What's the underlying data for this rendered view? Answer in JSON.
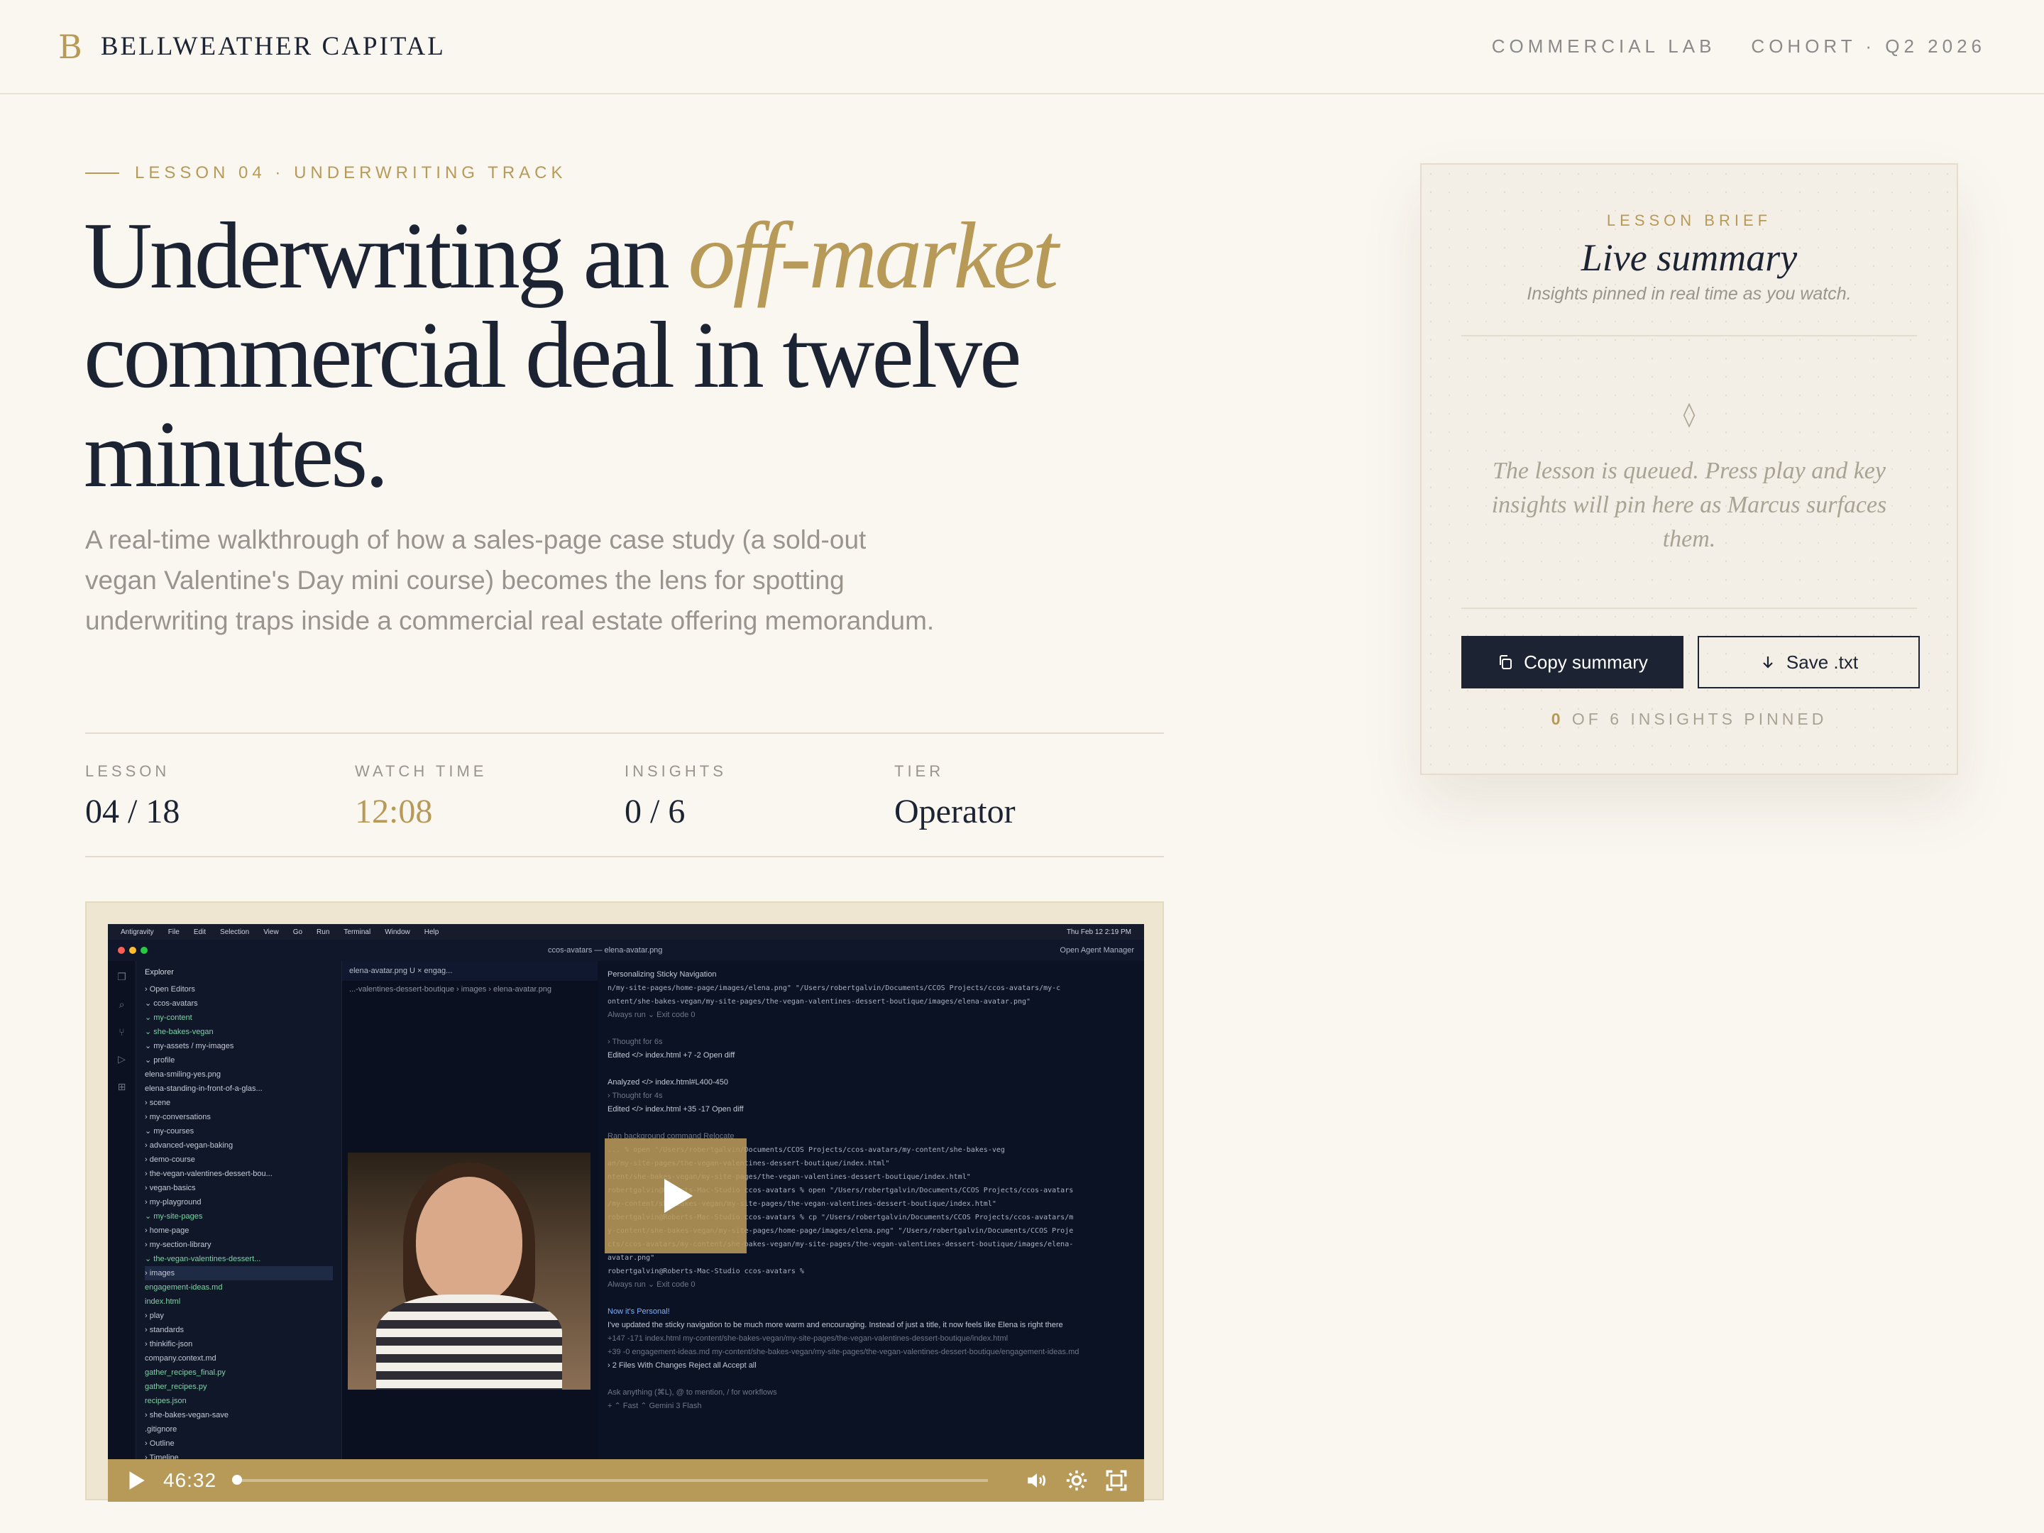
{
  "header": {
    "brand_mark": "B",
    "brand_name": "BELLWEATHER CAPITAL",
    "links": [
      "COMMERCIAL LAB",
      "COHORT · Q2 2026"
    ]
  },
  "hero": {
    "eyebrow": "LESSON 04 · UNDERWRITING TRACK",
    "headline_pre": "Underwriting an ",
    "headline_em": "off-market",
    "headline_post": " commercial deal in twelve minutes.",
    "lede": "A real-time walkthrough of how a sales-page case study (a sold-out vegan Valentine's Day mini course) becomes the lens for spotting underwriting traps inside a commercial real estate offering memorandum."
  },
  "stats": [
    {
      "label": "LESSON",
      "value": "04 / 18"
    },
    {
      "label": "WATCH TIME",
      "value": "12:08"
    },
    {
      "label": "INSIGHTS",
      "value": "0 / 6"
    },
    {
      "label": "TIER",
      "value": "Operator"
    }
  ],
  "video": {
    "current_time": "46:32",
    "progress": 0.0,
    "screen": {
      "menubar": [
        "Antigravity",
        "File",
        "Edit",
        "Selection",
        "View",
        "Go",
        "Run",
        "Terminal",
        "Window",
        "Help"
      ],
      "menubar_right": "Thu Feb 12 2:19 PM",
      "window_title": "ccos-avatars — elena-avatar.png",
      "agent_manager": "Open Agent Manager",
      "explorer_title": "Explorer",
      "tree": [
        {
          "label": "› Open Editors",
          "style": ""
        },
        {
          "label": "⌄ ccos-avatars",
          "style": ""
        },
        {
          "label": "  ⌄ my-content",
          "style": "green"
        },
        {
          "label": "    ⌄ she-bakes-vegan",
          "style": "green"
        },
        {
          "label": "      ⌄ my-assets / my-images",
          "style": ""
        },
        {
          "label": "        ⌄ profile",
          "style": ""
        },
        {
          "label": "          elena-smiling-yes.png",
          "style": ""
        },
        {
          "label": "          elena-standing-in-front-of-a-glas...",
          "style": ""
        },
        {
          "label": "        › scene",
          "style": ""
        },
        {
          "label": "      › my-conversations",
          "style": ""
        },
        {
          "label": "      ⌄ my-courses",
          "style": ""
        },
        {
          "label": "        › advanced-vegan-baking",
          "style": ""
        },
        {
          "label": "        › demo-course",
          "style": ""
        },
        {
          "label": "        › the-vegan-valentines-dessert-bou...",
          "style": ""
        },
        {
          "label": "        › vegan-basics",
          "style": ""
        },
        {
          "label": "      › my-playground",
          "style": ""
        },
        {
          "label": "      ⌄ my-site-pages",
          "style": "green"
        },
        {
          "label": "        › home-page",
          "style": ""
        },
        {
          "label": "        › my-section-library",
          "style": ""
        },
        {
          "label": "        ⌄ the-vegan-valentines-dessert...",
          "style": "green"
        },
        {
          "label": "          › images",
          "style": "sel"
        },
        {
          "label": "          engagement-ideas.md",
          "style": "green"
        },
        {
          "label": "          index.html",
          "style": "green"
        },
        {
          "label": "    › play",
          "style": ""
        },
        {
          "label": "    › standards",
          "style": ""
        },
        {
          "label": "    › thinkific-json",
          "style": ""
        },
        {
          "label": "      company.context.md",
          "style": ""
        },
        {
          "label": "      gather_recipes_final.py",
          "style": "green"
        },
        {
          "label": "      gather_recipes.py",
          "style": "green"
        },
        {
          "label": "      recipes.json",
          "style": "green"
        },
        {
          "label": "    › she-bakes-vegan-save",
          "style": ""
        },
        {
          "label": "      .gitignore",
          "style": ""
        },
        {
          "label": "› Outline",
          "style": ""
        },
        {
          "label": "› Timeline",
          "style": ""
        }
      ],
      "editor_tab": "elena-avatar.png U  ×   engag...",
      "editor_crumb": "...-valentines-dessert-boutique › images › elena-avatar.png",
      "chat_title": "Personalizing Sticky Navigation",
      "chat": [
        {
          "text": "n/my-site-pages/home-page/images/elena.png\" \"/Users/robertgalvin/Documents/CCOS Projects/ccos-avatars/my-c",
          "style": "code"
        },
        {
          "text": "ontent/she-bakes-vegan/my-site-pages/the-vegan-valentines-dessert-boutique/images/elena-avatar.png\"",
          "style": "code"
        },
        {
          "text": "Always run ⌄                                                                  Exit code 0",
          "style": "dim"
        },
        {
          "text": "",
          "style": ""
        },
        {
          "text": "› Thought for 6s",
          "style": "dim"
        },
        {
          "text": "Edited  </> index.html  +7 -2                                                Open diff",
          "style": ""
        },
        {
          "text": "",
          "style": ""
        },
        {
          "text": "Analyzed  </> index.html#L400-450",
          "style": ""
        },
        {
          "text": "› Thought for 4s",
          "style": "dim"
        },
        {
          "text": "Edited  </> index.html  +35 -17                                              Open diff",
          "style": ""
        },
        {
          "text": "",
          "style": ""
        },
        {
          "text": "Ran background command                                                    Relocate",
          "style": "dim"
        },
        {
          "text": "... % open \"/Users/robertgalvin/Documents/CCOS Projects/ccos-avatars/my-content/she-bakes-veg",
          "style": "code"
        },
        {
          "text": "an/my-site-pages/the-vegan-valentines-dessert-boutique/index.html\"",
          "style": "code"
        },
        {
          "text": "ntent/she-bakes-vegan/my-site-pages/the-vegan-valentines-dessert-boutique/index.html\"",
          "style": "code"
        },
        {
          "text": "robertgalvin@Roberts-Mac-Studio ccos-avatars % open \"/Users/robertgalvin/Documents/CCOS Projects/ccos-avatars",
          "style": "code"
        },
        {
          "text": "/my-content/she-bakes-vegan/my-site-pages/the-vegan-valentines-dessert-boutique/index.html\"",
          "style": "code"
        },
        {
          "text": "robertgalvin@Roberts-Mac-Studio ccos-avatars % cp \"/Users/robertgalvin/Documents/CCOS Projects/ccos-avatars/m",
          "style": "code"
        },
        {
          "text": "y-content/she-bakes-vegan/my-site-pages/home-page/images/elena.png\" \"/Users/robertgalvin/Documents/CCOS Proje",
          "style": "code"
        },
        {
          "text": "cts/ccos-avatars/my-content/she-bakes-vegan/my-site-pages/the-vegan-valentines-dessert-boutique/images/elena-",
          "style": "code"
        },
        {
          "text": "avatar.png\"",
          "style": "code"
        },
        {
          "text": "robertgalvin@Roberts-Mac-Studio ccos-avatars %",
          "style": "code"
        },
        {
          "text": "Always run ⌄                                                                  Exit code 0",
          "style": "dim"
        },
        {
          "text": "",
          "style": ""
        },
        {
          "text": "Now it's Personal!",
          "style": "accent"
        },
        {
          "text": "I've updated the sticky navigation to be much more warm and encouraging. Instead of just a title, it now feels like Elena is right there",
          "style": ""
        },
        {
          "text": "+147 -171  index.html  my-content/she-bakes-vegan/my-site-pages/the-vegan-valentines-dessert-boutique/index.html",
          "style": "dim"
        },
        {
          "text": "+39 -0   engagement-ideas.md  my-content/she-bakes-vegan/my-site-pages/the-vegan-valentines-dessert-boutique/engagement-ideas.md",
          "style": "dim"
        },
        {
          "text": "› 2 Files With Changes                                                  Reject all   Accept all",
          "style": ""
        },
        {
          "text": "",
          "style": ""
        },
        {
          "text": "Ask anything (⌘L), @ to mention, / for workflows",
          "style": "dim"
        },
        {
          "text": "+  ⌃ Fast   ⌃ Gemini 3 Flash",
          "style": "dim"
        }
      ]
    }
  },
  "card": {
    "kicker": "LESSON BRIEF",
    "title": "Live summary",
    "subtitle": "Insights pinned in real time as you watch.",
    "empty": "The lesson is queued. Press play and key insights will pin here as Marcus surfaces them.",
    "copy_label": "Copy summary",
    "save_label": "Save .txt",
    "pinned_count": "0",
    "pinned_rest": " OF 6 INSIGHTS PINNED"
  },
  "colors": {
    "accent": "#b89a58",
    "ink": "#1c2333",
    "background": "#faf7f1"
  }
}
